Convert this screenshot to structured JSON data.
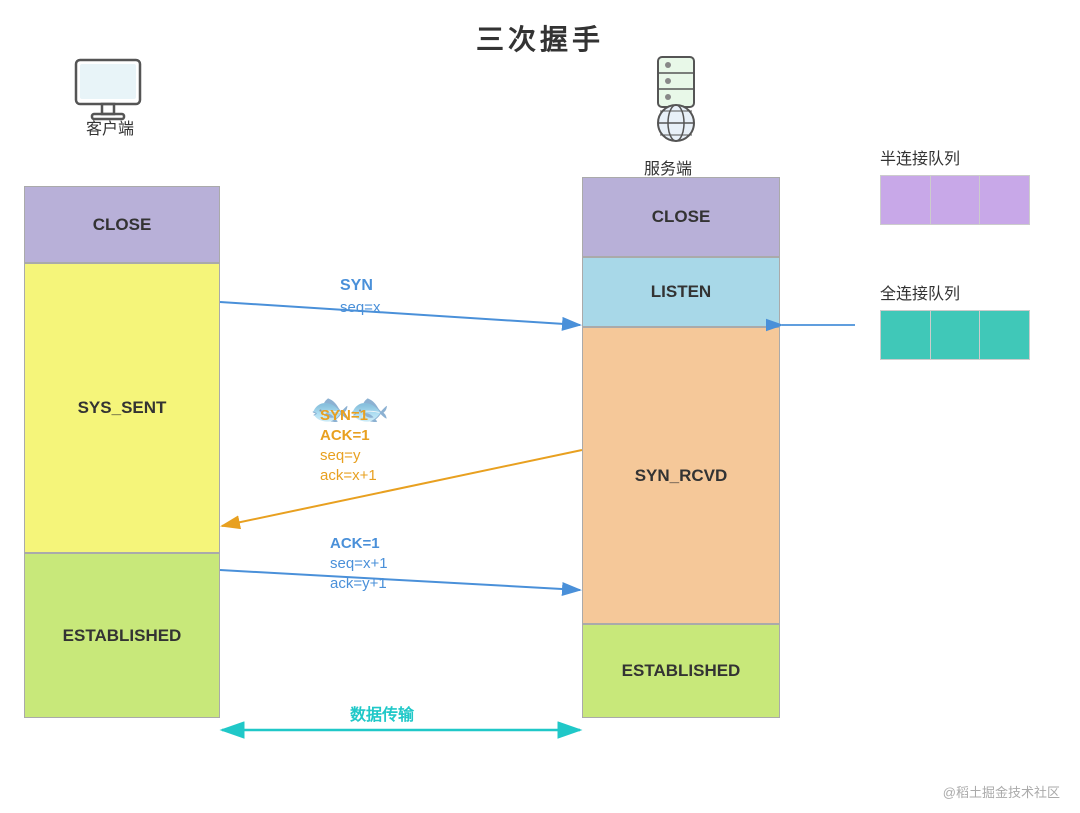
{
  "title": "三次握手",
  "client": {
    "label": "客户端",
    "states": {
      "close": "CLOSE",
      "sys_sent": "SYS_SENT",
      "established": "ESTABLISHED"
    }
  },
  "server": {
    "label": "服务端",
    "states": {
      "close": "CLOSE",
      "listen": "LISTEN",
      "syn_rcvd": "SYN_RCVD",
      "established": "ESTABLISHED"
    }
  },
  "arrows": {
    "syn": {
      "label1": "SYN",
      "label2": "seq=x"
    },
    "syn_ack": {
      "label1": "SYN=1",
      "label2": "ACK=1",
      "label3": "seq=y",
      "label4": "ack=x+1"
    },
    "ack": {
      "label1": "ACK=1",
      "label2": "seq=x+1",
      "label3": "ack=y+1"
    },
    "data": {
      "label": "数据传输"
    }
  },
  "queues": {
    "half": {
      "label": "半连接队列"
    },
    "full": {
      "label": "全连接队列"
    }
  },
  "watermark": "@稻土掘金技术社区"
}
